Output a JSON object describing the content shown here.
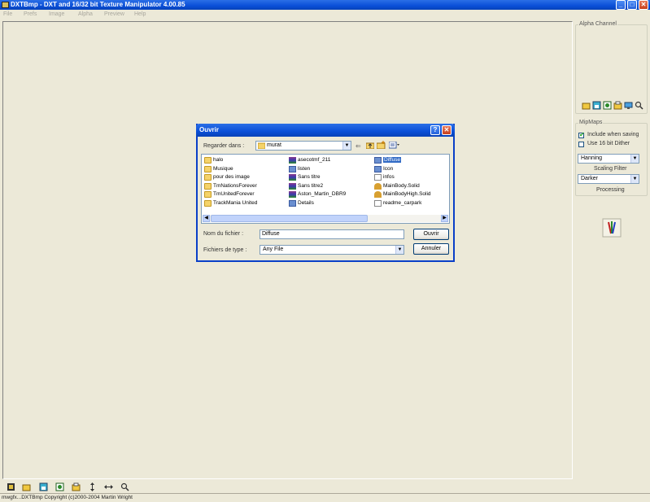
{
  "window": {
    "title": "DXTBmp - DXT and 16/32 bit Texture Manipulator  4.00.85",
    "min": "_",
    "max": "□",
    "close": "✕"
  },
  "menu": [
    "File",
    "Prefs",
    "Image",
    "Alpha",
    "Preview",
    "Help"
  ],
  "panel": {
    "alpha_channel": "Alpha Channel",
    "mipmaps": "MipMaps",
    "include_when_saving": "Include when saving",
    "include_checked": true,
    "use_16bit_dither": "Use 16 bit Dither",
    "dither_checked": false,
    "scaling_value": "Hanning",
    "scaling_filter": "Scaling Filter",
    "processing_value": "Darker",
    "processing": "Processing"
  },
  "dialog": {
    "title": "Ouvrir",
    "help": "?",
    "close": "✕",
    "look_in_label": "Regarder dans :",
    "look_in_value": "murat",
    "files": [
      {
        "name": "halo",
        "icon": "folder-icon",
        "type": "folder"
      },
      {
        "name": "Musique",
        "icon": "folder-icon",
        "type": "folder"
      },
      {
        "name": "pour des image",
        "icon": "folder-icon",
        "type": "folder"
      },
      {
        "name": "TmNationsForever",
        "icon": "folder-icon",
        "type": "folder"
      },
      {
        "name": "TmUnitedForever",
        "icon": "folder-icon",
        "type": "folder"
      },
      {
        "name": "TrackMania United",
        "icon": "folder-icon",
        "type": "folder"
      },
      {
        "name": "asecotmf_211",
        "icon": "archive-icon",
        "type": "rar"
      },
      {
        "name": "listen",
        "icon": "image-file-icon",
        "type": "img"
      },
      {
        "name": "Sans titre",
        "icon": "archive-icon",
        "type": "rar"
      },
      {
        "name": "Sans titre2",
        "icon": "archive-icon",
        "type": "rar"
      },
      {
        "name": "Aston_Martin_DBR9",
        "icon": "archive-icon",
        "type": "rar"
      },
      {
        "name": "Details",
        "icon": "image-file-icon",
        "type": "img"
      },
      {
        "name": "Diffuse",
        "icon": "image-file-icon",
        "type": "img",
        "selected": true
      },
      {
        "name": "Icon",
        "icon": "image-file-icon",
        "type": "img"
      },
      {
        "name": "infos",
        "icon": "text-file-icon",
        "type": "doc"
      },
      {
        "name": "MainBody.Solid",
        "icon": "solid-file-icon",
        "type": "solid"
      },
      {
        "name": "MainBodyHigh.Solid",
        "icon": "solid-file-icon",
        "type": "solid"
      },
      {
        "name": "readme_carpark",
        "icon": "text-file-icon",
        "type": "doc"
      }
    ],
    "filename_label": "Nom du fichier :",
    "filename_value": "Diffuse",
    "filetype_label": "Fichiers de type :",
    "filetype_value": "Any File",
    "open_button": "Ouvrir",
    "cancel_button": "Annuler"
  },
  "status": "mwgfx...DXTBmp Copyright (c)2000-2004 Martin Wright"
}
